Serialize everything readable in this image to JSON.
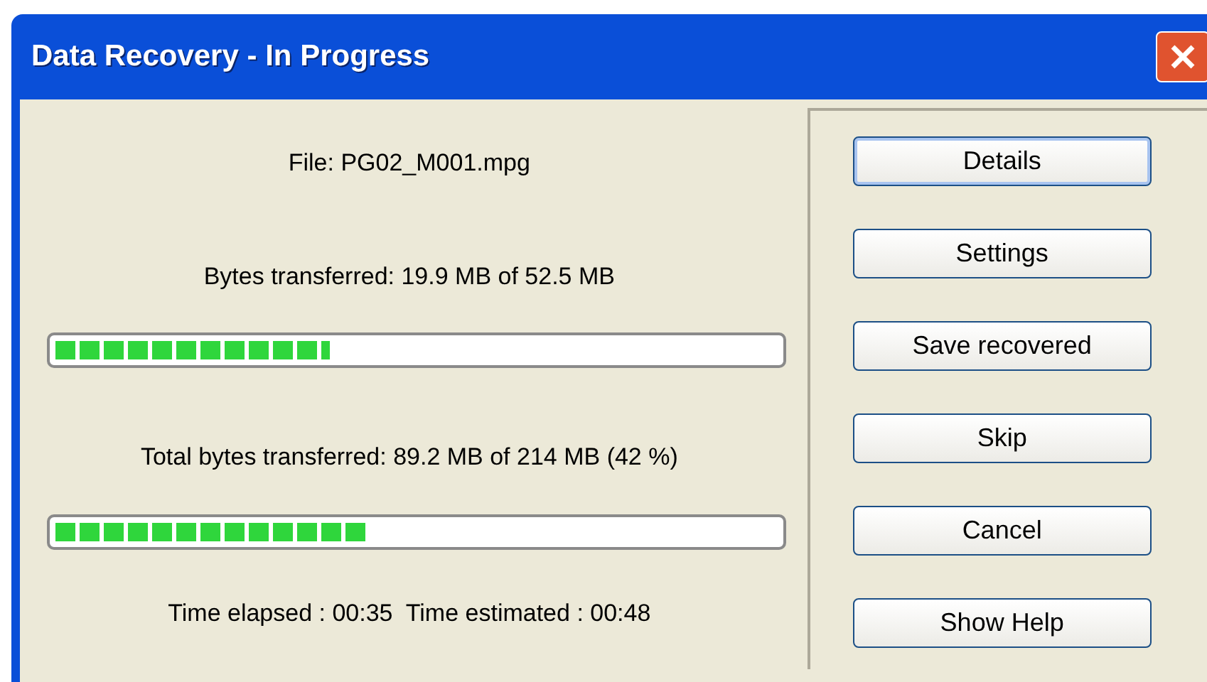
{
  "window": {
    "title": "Data Recovery - In Progress"
  },
  "file": "File: PG02_M001.mpg",
  "progress": [
    {
      "label": "Bytes transferred: 19.9 MB of 52.5 MB",
      "level": 0.38
    },
    {
      "label": "Total bytes transferred: 89.2 MB of 214 MB (42 %)",
      "level": 0.43
    }
  ],
  "time": "Time elapsed : 00:35  Time estimated : 00:48",
  "buttons": [
    {
      "label": "Details",
      "focused": true
    },
    {
      "label": "Settings",
      "focused": false
    },
    {
      "label": "Save recovered",
      "focused": false
    },
    {
      "label": "Skip",
      "focused": false
    },
    {
      "label": "Cancel",
      "focused": false
    },
    {
      "label": "Show Help",
      "focused": false
    }
  ]
}
